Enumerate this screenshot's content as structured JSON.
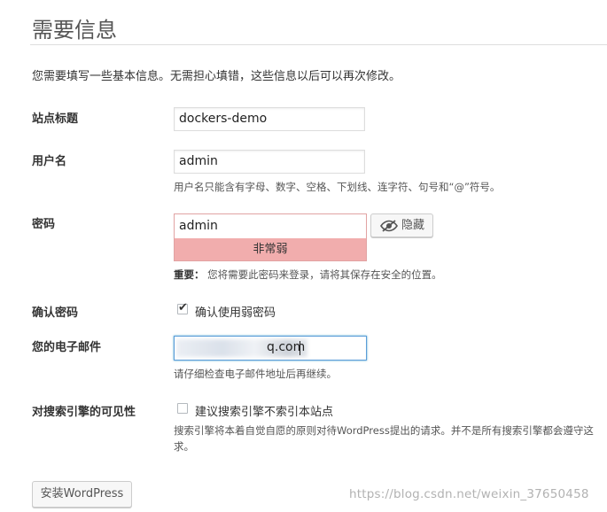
{
  "heading": "需要信息",
  "intro": "您需要填写一些基本信息。无需担心填错，这些信息以后可以再次修改。",
  "site_title": {
    "label": "站点标题",
    "value": "dockers-demo"
  },
  "username": {
    "label": "用户名",
    "value": "admin",
    "hint": "用户名只能含有字母、数字、空格、下划线、连字符、句号和“@”符号。"
  },
  "password": {
    "label": "密码",
    "value": "admin",
    "strength": "非常弱",
    "hide_label": "隐藏",
    "note_strong": "重要：",
    "note": "您将需要此密码来登录，请将其保存在安全的位置。"
  },
  "confirm_password": {
    "label": "确认密码",
    "checkbox_label": "确认使用弱密码",
    "checked": true
  },
  "email": {
    "label": "您的电子邮件",
    "value_visible": "q.com",
    "hint": "请仔细检查电子邮件地址后再继续。"
  },
  "search_visibility": {
    "label": "对搜索引擎的可见性",
    "checkbox_label": "建议搜索引擎不索引本站点",
    "checked": false,
    "hint_line1": "搜索引擎将本着自觉自愿的原则对待WordPress提出的请求。并不是所有搜索引擎都会遵守这",
    "hint_line2": "求。"
  },
  "install_button": "安装WordPress",
  "watermark": "https://blog.csdn.net/weixin_37650458",
  "colors": {
    "strength_bg": "#f1adad",
    "strength_border": "#e1a3a3",
    "focus_border": "#5b9dd9"
  }
}
